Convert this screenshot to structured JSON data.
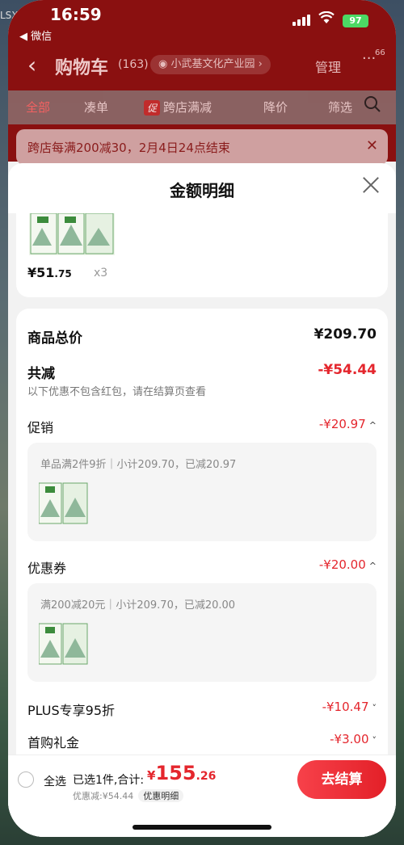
{
  "desktop": {
    "label": "LSX"
  },
  "status_bar": {
    "time": "16:59",
    "back_app": "◀ 微信",
    "battery": "97"
  },
  "nav": {
    "title": "购物车",
    "count": "(163)",
    "location": "小武基文化产业园 ›",
    "manage": "管理",
    "more_badge": "66"
  },
  "filters": [
    "全部",
    "凑单",
    "跨店满减",
    "降价",
    "筛选"
  ],
  "filter_promo_badge": "促",
  "banner": {
    "text": "跨店每满200减30，2月4日24点结束"
  },
  "sheet": {
    "title": "金额明细",
    "item": {
      "price_int": "¥51",
      "price_dec": ".75",
      "qty": "x3"
    },
    "total_label": "商品总价",
    "total_value": "¥209.70",
    "reduce_label": "共减",
    "reduce_value": "-¥54.44",
    "reduce_note": "以下优惠不包含红包，请在结算页查看",
    "promo_label": "促销",
    "promo_value": "-¥20.97",
    "promo_detail": "单品满2件9折｜小计209.70，已减20.97",
    "coupon_label": "优惠券",
    "coupon_value": "-¥20.00",
    "coupon_detail": "满200减20元｜小计209.70，已减20.00",
    "plus_label": "PLUS专享95折",
    "plus_value": "-¥10.47",
    "first_label": "首购礼金",
    "first_value": "-¥3.00"
  },
  "bottom": {
    "select_all": "全选",
    "selected": "已选1件,合计:",
    "total_cur": "¥",
    "total_int": "155",
    "total_dec": ".26",
    "discount_line": "优惠减:¥54.44",
    "discount_detail": "优惠明细",
    "checkout": "去结算"
  },
  "colors": {
    "accent": "#e4262d",
    "header": "#8a1010"
  }
}
